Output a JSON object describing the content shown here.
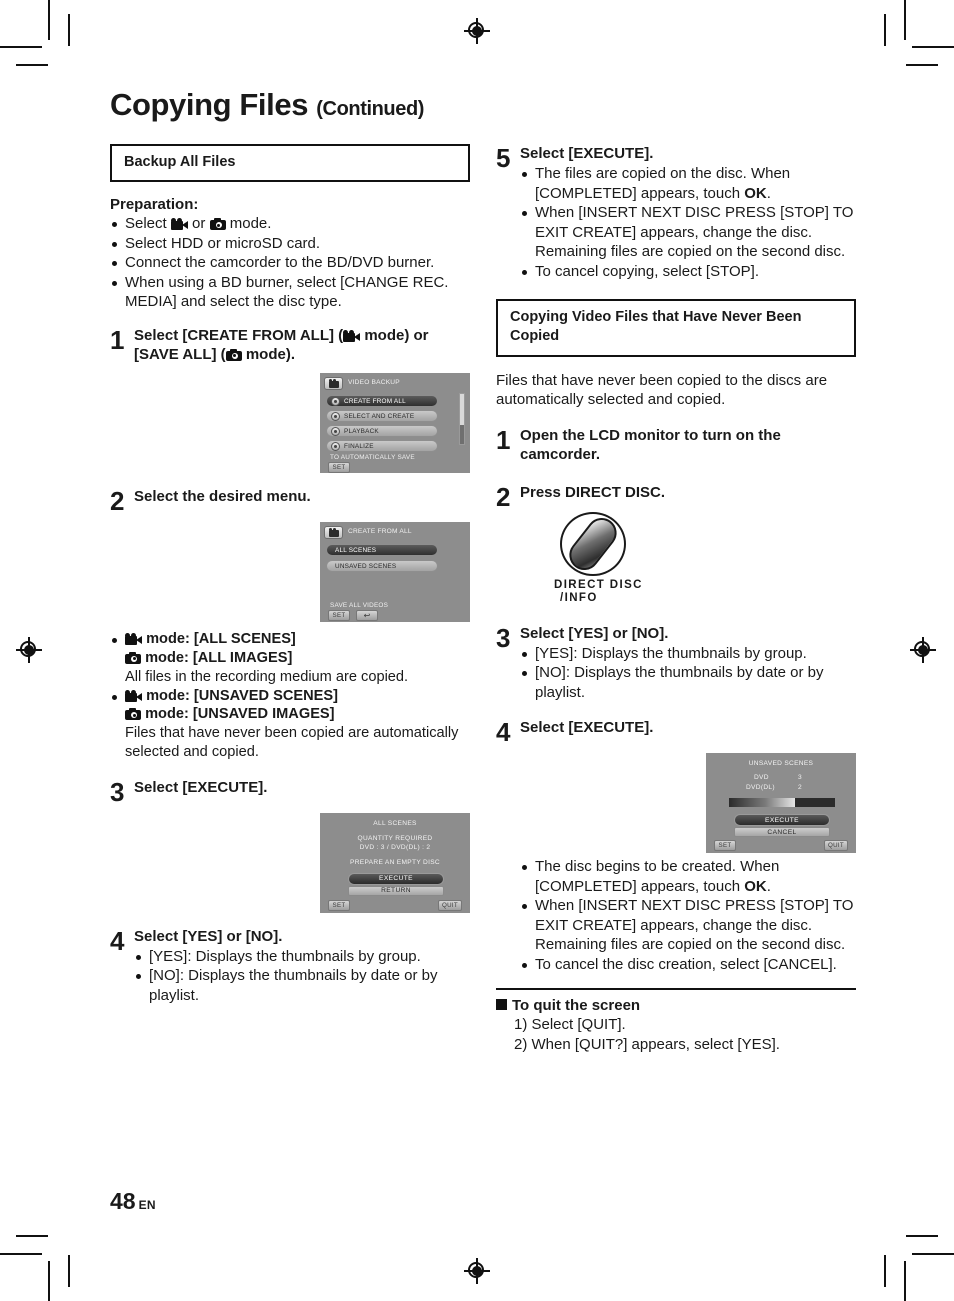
{
  "document": {
    "title": "Copying Files",
    "title_suffix": "(Continued)",
    "page_number": "48",
    "page_locale": "EN"
  },
  "left_column": {
    "section_header": "Backup All Files",
    "preparation": {
      "title": "Preparation:",
      "items": [
        "Select ▮ or ▮ mode.",
        "Select HDD or microSD card.",
        "Connect the camcorder to the BD/DVD burner.",
        "When using a BD burner, select [CHANGE REC. MEDIA] and select the disc type."
      ],
      "item1_pre": "Select",
      "item1_mid": "or",
      "item1_post": "mode.",
      "item2": "Select HDD or microSD card.",
      "item3": "Connect the camcorder to the BD/DVD burner.",
      "item4": "When using a BD burner, select [CHANGE REC. MEDIA] and select the disc type."
    },
    "steps": [
      {
        "num": "1",
        "head_part1": "Select [CREATE FROM ALL] (",
        "head_part2": "mode) or [SAVE ALL] (",
        "head_part3": "mode)."
      },
      {
        "num": "2",
        "head": "Select the desired menu."
      },
      {
        "num": "3",
        "head": "Select [EXECUTE]."
      },
      {
        "num": "4",
        "head": "Select [YES] or [NO].",
        "bullets": [
          "[YES]: Displays the thumbnails by group.",
          "[NO]: Displays the thumbnails by date or by playlist."
        ]
      }
    ],
    "mode_notes": [
      {
        "line1_suffix": "mode: [ALL SCENES]",
        "line2_suffix": "mode: [ALL IMAGES]",
        "desc": "All files in the recording medium are copied."
      },
      {
        "line1_suffix": "mode: [UNSAVED SCENES]",
        "line2_suffix": "mode: [UNSAVED IMAGES]",
        "desc": "Files that have never been copied are automatically selected and copied."
      }
    ]
  },
  "right_column": {
    "step5": {
      "num": "5",
      "head": "Select [EXECUTE].",
      "bullets": [
        "The files are copied on the disc. When [COMPLETED] appears, touch OK.",
        "When [INSERT NEXT DISC PRESS [STOP] TO EXIT CREATE] appears, change the disc. Remaining files are copied on the second disc.",
        "To cancel copying, select [STOP]."
      ],
      "bullet1_a": "The files are copied on the disc. When [COMPLETED] appears, touch ",
      "bullet1_ok": "OK",
      "bullet1_b": ".",
      "bullet2": "When [INSERT NEXT DISC PRESS [STOP] TO EXIT CREATE] appears, change the disc. Remaining files are copied on the second disc.",
      "bullet3": "To cancel copying, select [STOP]."
    },
    "section_header": "Copying Video Files that Have Never Been Copied",
    "intro": "Files that have never been copied to the discs are automatically selected and copied.",
    "steps": [
      {
        "num": "1",
        "head": "Open the LCD monitor to turn on the camcorder."
      },
      {
        "num": "2",
        "head": "Press DIRECT DISC."
      },
      {
        "num": "3",
        "head": "Select [YES] or [NO].",
        "bullets": [
          "[YES]: Displays the thumbnails by group.",
          "[NO]: Displays the thumbnails by date or by playlist."
        ]
      },
      {
        "num": "4",
        "head": "Select [EXECUTE]."
      }
    ],
    "step4_bullets": {
      "bullet1_a": "The disc begins to be created. When [COMPLETED] appears, touch ",
      "bullet1_ok": "OK",
      "bullet1_b": ".",
      "bullet2": "When [INSERT NEXT DISC PRESS [STOP] TO EXIT CREATE] appears, change the disc. Remaining files are copied on the second disc.",
      "bullet3": "To cancel the disc creation, select [CANCEL]."
    },
    "direct_disc_button": {
      "label_line1": "DIRECT DISC",
      "label_line2": "/INFO"
    },
    "quit_section": {
      "heading": "To quit the screen",
      "items": [
        "1) Select [QUIT].",
        "2) When [QUIT?] appears, select [YES]."
      ]
    }
  },
  "lcd_screens": {
    "video_backup": {
      "title": "VIDEO BACKUP",
      "rows": [
        {
          "label": "CREATE FROM ALL",
          "selected": true
        },
        {
          "label": "SELECT AND CREATE",
          "selected": false
        },
        {
          "label": "PLAYBACK",
          "selected": false
        },
        {
          "label": "FINALIZE",
          "selected": false
        }
      ],
      "hint": "TO AUTOMATICALLY SAVE",
      "set_button": "SET"
    },
    "create_from_all": {
      "title": "CREATE FROM ALL",
      "rows": [
        {
          "label": "ALL SCENES",
          "selected": true
        },
        {
          "label": "UNSAVED SCENES",
          "selected": false
        }
      ],
      "hint": "SAVE ALL VIDEOS",
      "set_button": "SET",
      "back_button": "↩"
    },
    "all_scenes_quantity": {
      "title": "ALL SCENES",
      "line1": "QUANTITY REQUIRED",
      "line2": "DVD : 3 / DVD(DL) : 2",
      "line3": "PREPARE AN EMPTY DISC",
      "execute_button": "EXECUTE",
      "return_button": "RETURN",
      "set_button": "SET",
      "quit_button": "QUIT"
    },
    "unsaved_scenes_quantity": {
      "title": "UNSAVED SCENES",
      "dvd_label": "DVD",
      "dvd_value": "3",
      "dvd_dl_label": "DVD(DL)",
      "dvd_dl_value": "2",
      "execute_button": "EXECUTE",
      "cancel_button": "CANCEL",
      "set_button": "SET",
      "quit_button": "QUIT"
    }
  }
}
